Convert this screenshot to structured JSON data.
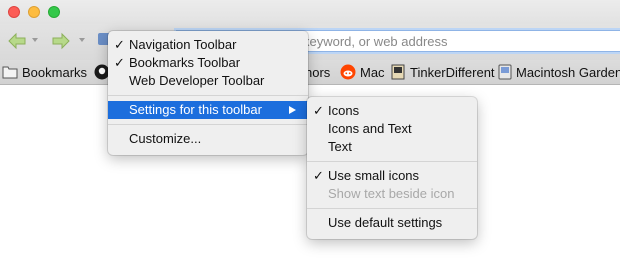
{
  "window": {
    "traffic_lights": [
      "close",
      "minimize",
      "maximize"
    ]
  },
  "navbar": {
    "back_icon": "arrow-left-icon",
    "forward_icon": "arrow-right-icon",
    "url_placeholder_visible": "keyword, or web address"
  },
  "bookmarks_bar": {
    "items": [
      {
        "label": "Bookmarks",
        "icon": "folder-icon"
      },
      {
        "label": "",
        "icon": "github-icon"
      },
      {
        "label": "nors",
        "icon": ""
      },
      {
        "label": "Mac",
        "icon": "reddit-icon"
      },
      {
        "label": "TinkerDifferent",
        "icon": "tinkerdifferent-icon"
      },
      {
        "label": "Macintosh Garden",
        "icon": "macintosh-garden-icon"
      }
    ]
  },
  "context_menu": {
    "items": [
      {
        "label": "Navigation Toolbar",
        "checked": true
      },
      {
        "label": "Bookmarks Toolbar",
        "checked": true
      },
      {
        "label": "Web Developer Toolbar",
        "checked": false
      },
      {
        "label": "Settings for this toolbar",
        "highlighted": true,
        "submenu": true
      },
      {
        "label": "Customize..."
      }
    ]
  },
  "submenu": {
    "items": [
      {
        "label": "Icons",
        "checked": true
      },
      {
        "label": "Icons and Text",
        "checked": false
      },
      {
        "label": "Text",
        "checked": false
      },
      {
        "label": "Use small icons",
        "checked": true
      },
      {
        "label": "Show text beside icon",
        "disabled": true
      },
      {
        "label": "Use default settings"
      }
    ]
  },
  "colors": {
    "highlight": "#1c6edd",
    "menu_bg": "#efefef",
    "disabled_text": "#a8a8a8"
  }
}
